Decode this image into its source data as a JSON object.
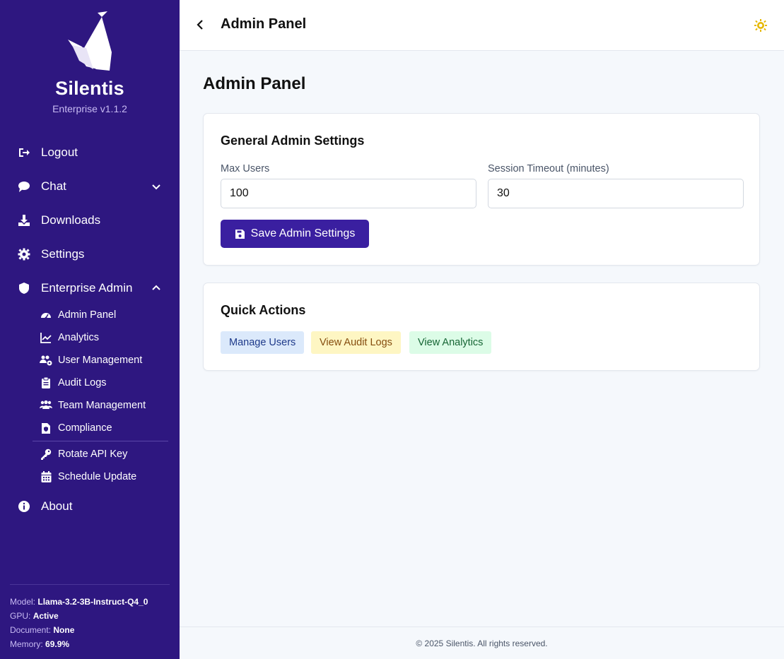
{
  "sidebar": {
    "brand": "Silentis",
    "version": "Enterprise v1.1.2",
    "nav": {
      "logout": "Logout",
      "chat": "Chat",
      "downloads": "Downloads",
      "settings": "Settings",
      "enterprise_admin": "Enterprise Admin",
      "about": "About"
    },
    "admin_sub": {
      "admin_panel": "Admin Panel",
      "analytics": "Analytics",
      "user_management": "User Management",
      "audit_logs": "Audit Logs",
      "team_management": "Team Management",
      "compliance": "Compliance",
      "rotate_api_key": "Rotate API Key",
      "schedule_update": "Schedule Update"
    },
    "status": {
      "model_label": "Model:",
      "model_value": "Llama-3.2-3B-Instruct-Q4_0",
      "gpu_label": "GPU:",
      "gpu_value": "Active",
      "document_label": "Document:",
      "document_value": "None",
      "memory_label": "Memory:",
      "memory_value": "69.9%"
    }
  },
  "header": {
    "title": "Admin Panel"
  },
  "main": {
    "title": "Admin Panel",
    "general": {
      "title": "General Admin Settings",
      "max_users_label": "Max Users",
      "max_users_value": "100",
      "session_timeout_label": "Session Timeout (minutes)",
      "session_timeout_value": "30",
      "save_label": "Save Admin Settings"
    },
    "quick_actions": {
      "title": "Quick Actions",
      "manage_users": "Manage Users",
      "view_audit_logs": "View Audit Logs",
      "view_analytics": "View Analytics"
    }
  },
  "footer": {
    "text": "© 2025 Silentis. All rights reserved."
  },
  "colors": {
    "sidebar_bg": "#2e1780",
    "accent": "#3a1fa0",
    "theme_icon": "#e6b800",
    "manage_users_bg": "#dbe9fb",
    "manage_users_fg": "#1e3a8a",
    "audit_logs_bg": "#fef6c3",
    "audit_logs_fg": "#854d0e",
    "analytics_bg": "#dcfce7",
    "analytics_fg": "#166534"
  }
}
